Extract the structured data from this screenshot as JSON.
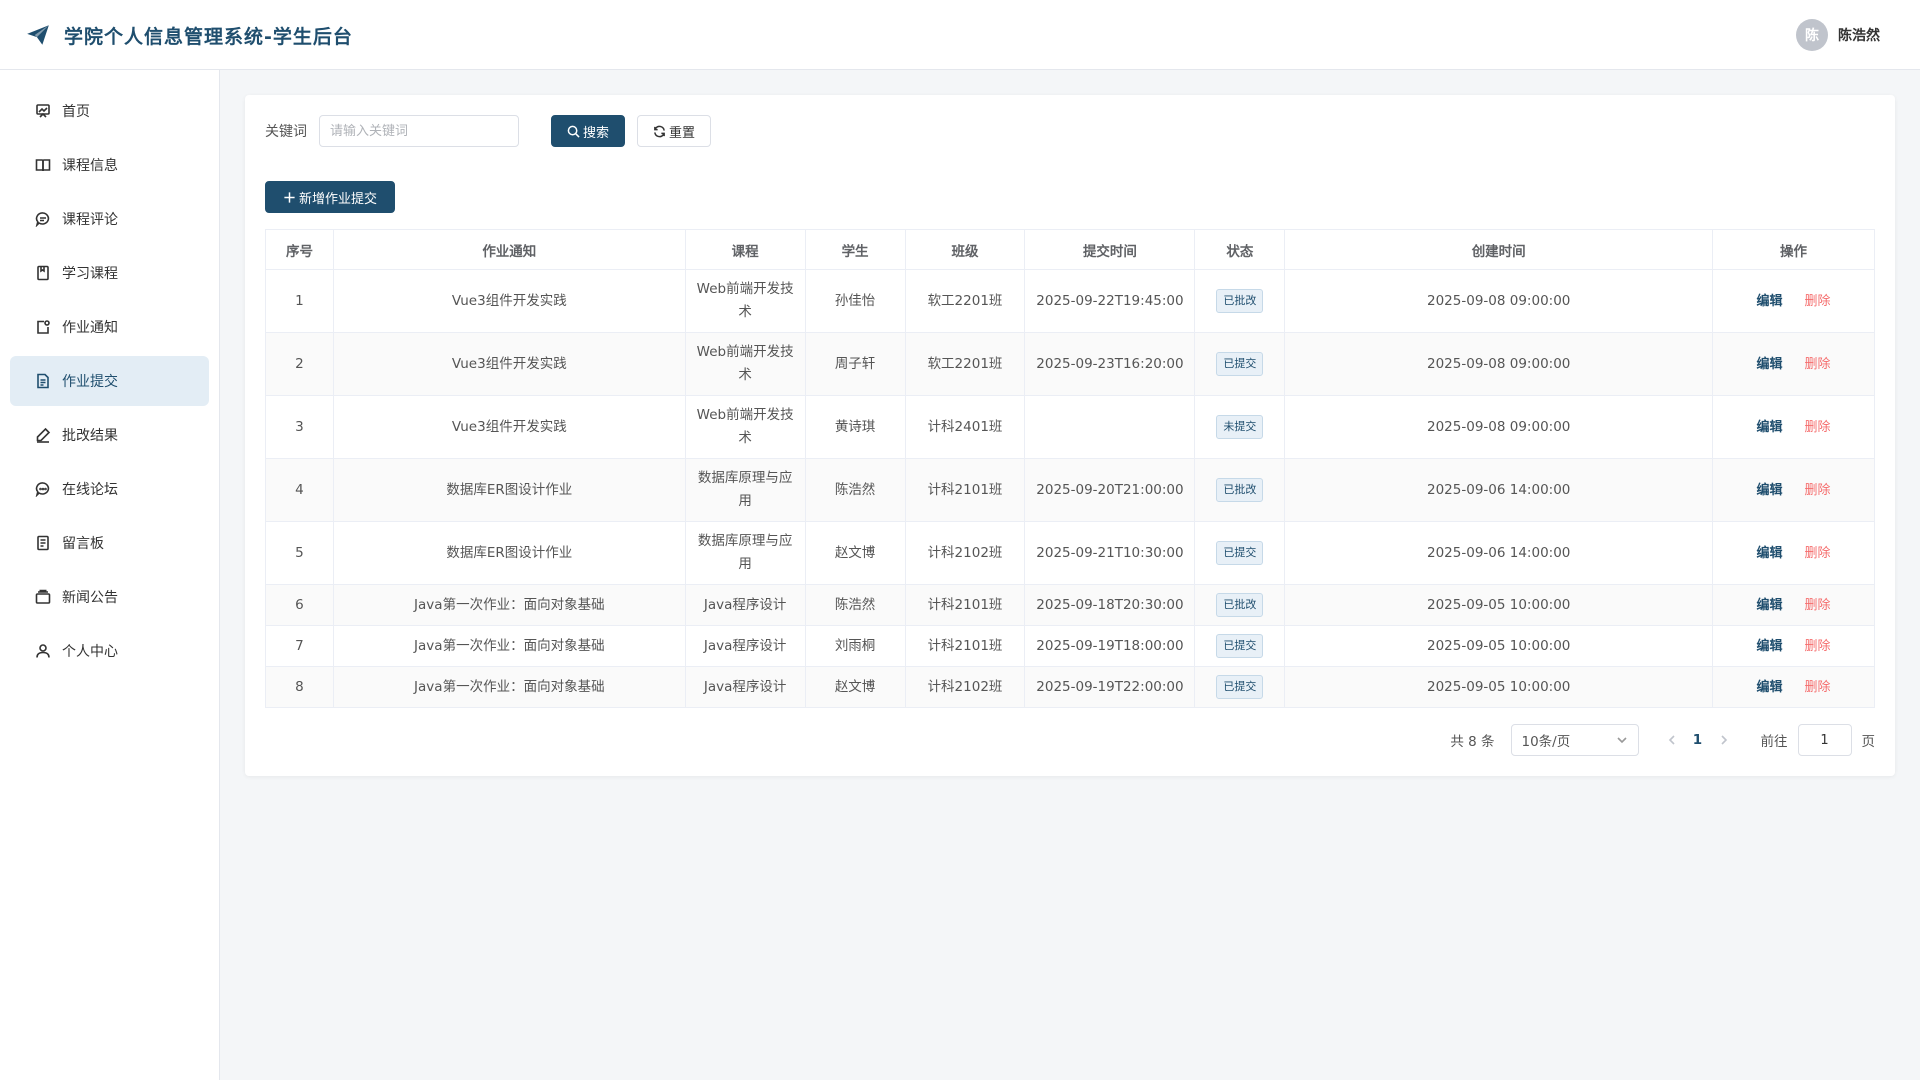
{
  "header": {
    "title": "学院个人信息管理系统-学生后台",
    "user": {
      "avatar_text": "陈",
      "name": "陈浩然"
    }
  },
  "sidebar": {
    "items": [
      {
        "label": "首页",
        "icon": "dashboard-icon"
      },
      {
        "label": "课程信息",
        "icon": "book-icon"
      },
      {
        "label": "课程评论",
        "icon": "comment-icon"
      },
      {
        "label": "学习课程",
        "icon": "notebook-icon"
      },
      {
        "label": "作业通知",
        "icon": "notice-icon"
      },
      {
        "label": "作业提交",
        "icon": "document-icon",
        "active": true
      },
      {
        "label": "批改结果",
        "icon": "edit-pen-icon"
      },
      {
        "label": "在线论坛",
        "icon": "chat-icon"
      },
      {
        "label": "留言板",
        "icon": "tickets-icon"
      },
      {
        "label": "新闻公告",
        "icon": "news-icon"
      },
      {
        "label": "个人中心",
        "icon": "user-icon"
      }
    ]
  },
  "search": {
    "label": "关键词",
    "placeholder": "请输入关键词",
    "search_button": "搜索",
    "reset_button": "重置"
  },
  "add_button": "新增作业提交",
  "table": {
    "columns": [
      "序号",
      "作业通知",
      "课程",
      "学生",
      "班级",
      "提交时间",
      "状态",
      "创建时间",
      "操作"
    ],
    "edit_label": "编辑",
    "delete_label": "删除",
    "rows": [
      {
        "no": "1",
        "notice": "Vue3组件开发实践",
        "course": "Web前端开发技术",
        "student": "孙佳怡",
        "class": "软工2201班",
        "submit_time": "2025-09-22T19:45:00",
        "status": "已批改",
        "created": "2025-09-08 09:00:00"
      },
      {
        "no": "2",
        "notice": "Vue3组件开发实践",
        "course": "Web前端开发技术",
        "student": "周子轩",
        "class": "软工2201班",
        "submit_time": "2025-09-23T16:20:00",
        "status": "已提交",
        "created": "2025-09-08 09:00:00"
      },
      {
        "no": "3",
        "notice": "Vue3组件开发实践",
        "course": "Web前端开发技术",
        "student": "黄诗琪",
        "class": "计科2401班",
        "submit_time": "",
        "status": "未提交",
        "created": "2025-09-08 09:00:00"
      },
      {
        "no": "4",
        "notice": "数据库ER图设计作业",
        "course": "数据库原理与应用",
        "student": "陈浩然",
        "class": "计科2101班",
        "submit_time": "2025-09-20T21:00:00",
        "status": "已批改",
        "created": "2025-09-06 14:00:00"
      },
      {
        "no": "5",
        "notice": "数据库ER图设计作业",
        "course": "数据库原理与应用",
        "student": "赵文博",
        "class": "计科2102班",
        "submit_time": "2025-09-21T10:30:00",
        "status": "已提交",
        "created": "2025-09-06 14:00:00"
      },
      {
        "no": "6",
        "notice": "Java第一次作业：面向对象基础",
        "course": "Java程序设计",
        "student": "陈浩然",
        "class": "计科2101班",
        "submit_time": "2025-09-18T20:30:00",
        "status": "已批改",
        "created": "2025-09-05 10:00:00"
      },
      {
        "no": "7",
        "notice": "Java第一次作业：面向对象基础",
        "course": "Java程序设计",
        "student": "刘雨桐",
        "class": "计科2101班",
        "submit_time": "2025-09-19T18:00:00",
        "status": "已提交",
        "created": "2025-09-05 10:00:00"
      },
      {
        "no": "8",
        "notice": "Java第一次作业：面向对象基础",
        "course": "Java程序设计",
        "student": "赵文博",
        "class": "计科2102班",
        "submit_time": "2025-09-19T22:00:00",
        "status": "已提交",
        "created": "2025-09-05 10:00:00"
      }
    ]
  },
  "pagination": {
    "total": "共 8 条",
    "page_size": "10条/页",
    "current_page": "1",
    "goto_label": "前往",
    "goto_value": "1",
    "page_unit": "页"
  },
  "colors": {
    "brand": "#1f4e6e",
    "danger": "#f56c6c",
    "active_bg": "#e3edf5"
  }
}
